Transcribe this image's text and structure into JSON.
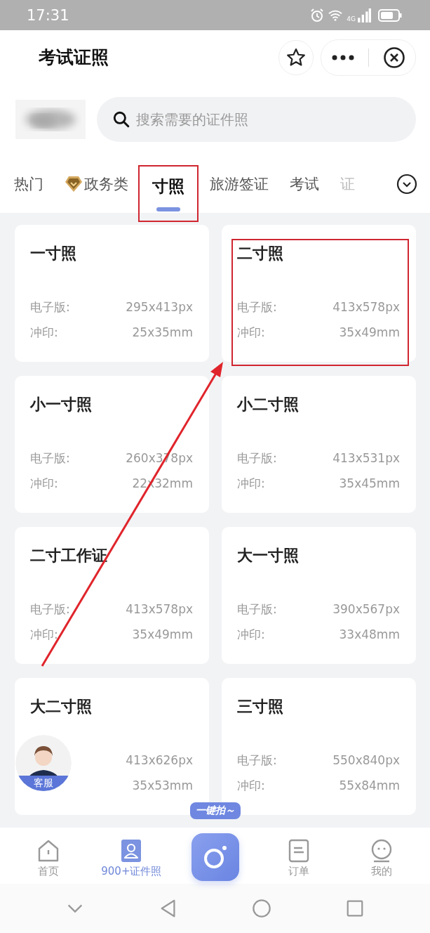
{
  "status_bar": {
    "time": "17:31",
    "network": "4G"
  },
  "header": {
    "title": "考试证照"
  },
  "search": {
    "placeholder": "搜索需要的证件照"
  },
  "tabs": [
    {
      "label": "热门",
      "selected": false,
      "badge": false,
      "highlighted": false
    },
    {
      "label": "政务类",
      "selected": false,
      "badge": true,
      "highlighted": false
    },
    {
      "label": "寸照",
      "selected": true,
      "badge": false,
      "highlighted": true
    },
    {
      "label": "旅游签证",
      "selected": false,
      "badge": false,
      "highlighted": false
    },
    {
      "label": "考试",
      "selected": false,
      "badge": false,
      "highlighted": false
    },
    {
      "label": "证",
      "selected": false,
      "badge": false,
      "highlighted": false
    }
  ],
  "cards": [
    {
      "title": "一寸照",
      "digital_label": "电子版:",
      "digital": "295x413px",
      "print_label": "冲印:",
      "print": "25x35mm",
      "highlighted": false
    },
    {
      "title": "二寸照",
      "digital_label": "电子版:",
      "digital": "413x578px",
      "print_label": "冲印:",
      "print": "35x49mm",
      "highlighted": true
    },
    {
      "title": "小一寸照",
      "digital_label": "电子版:",
      "digital": "260x378px",
      "print_label": "冲印:",
      "print": "22x32mm",
      "highlighted": false
    },
    {
      "title": "小二寸照",
      "digital_label": "电子版:",
      "digital": "413x531px",
      "print_label": "冲印:",
      "print": "35x45mm",
      "highlighted": false
    },
    {
      "title": "二寸工作证",
      "digital_label": "电子版:",
      "digital": "413x578px",
      "print_label": "冲印:",
      "print": "35x49mm",
      "highlighted": false
    },
    {
      "title": "大一寸照",
      "digital_label": "电子版:",
      "digital": "390x567px",
      "print_label": "冲印:",
      "print": "33x48mm",
      "highlighted": false
    },
    {
      "title": "大二寸照",
      "digital": "413x626px",
      "print": "35x53mm",
      "highlighted": false
    },
    {
      "title": "三寸照",
      "digital_label": "电子版:",
      "digital": "550x840px",
      "print_label": "冲印:",
      "print": "55x84mm",
      "highlighted": false
    }
  ],
  "service": {
    "label": "客服"
  },
  "camera": {
    "tooltip": "一键拍～"
  },
  "nav": [
    {
      "label": "首页",
      "selected": false
    },
    {
      "label": "900+证件照",
      "selected": true
    },
    {
      "label": "订单",
      "selected": false
    },
    {
      "label": "我的",
      "selected": false
    }
  ]
}
